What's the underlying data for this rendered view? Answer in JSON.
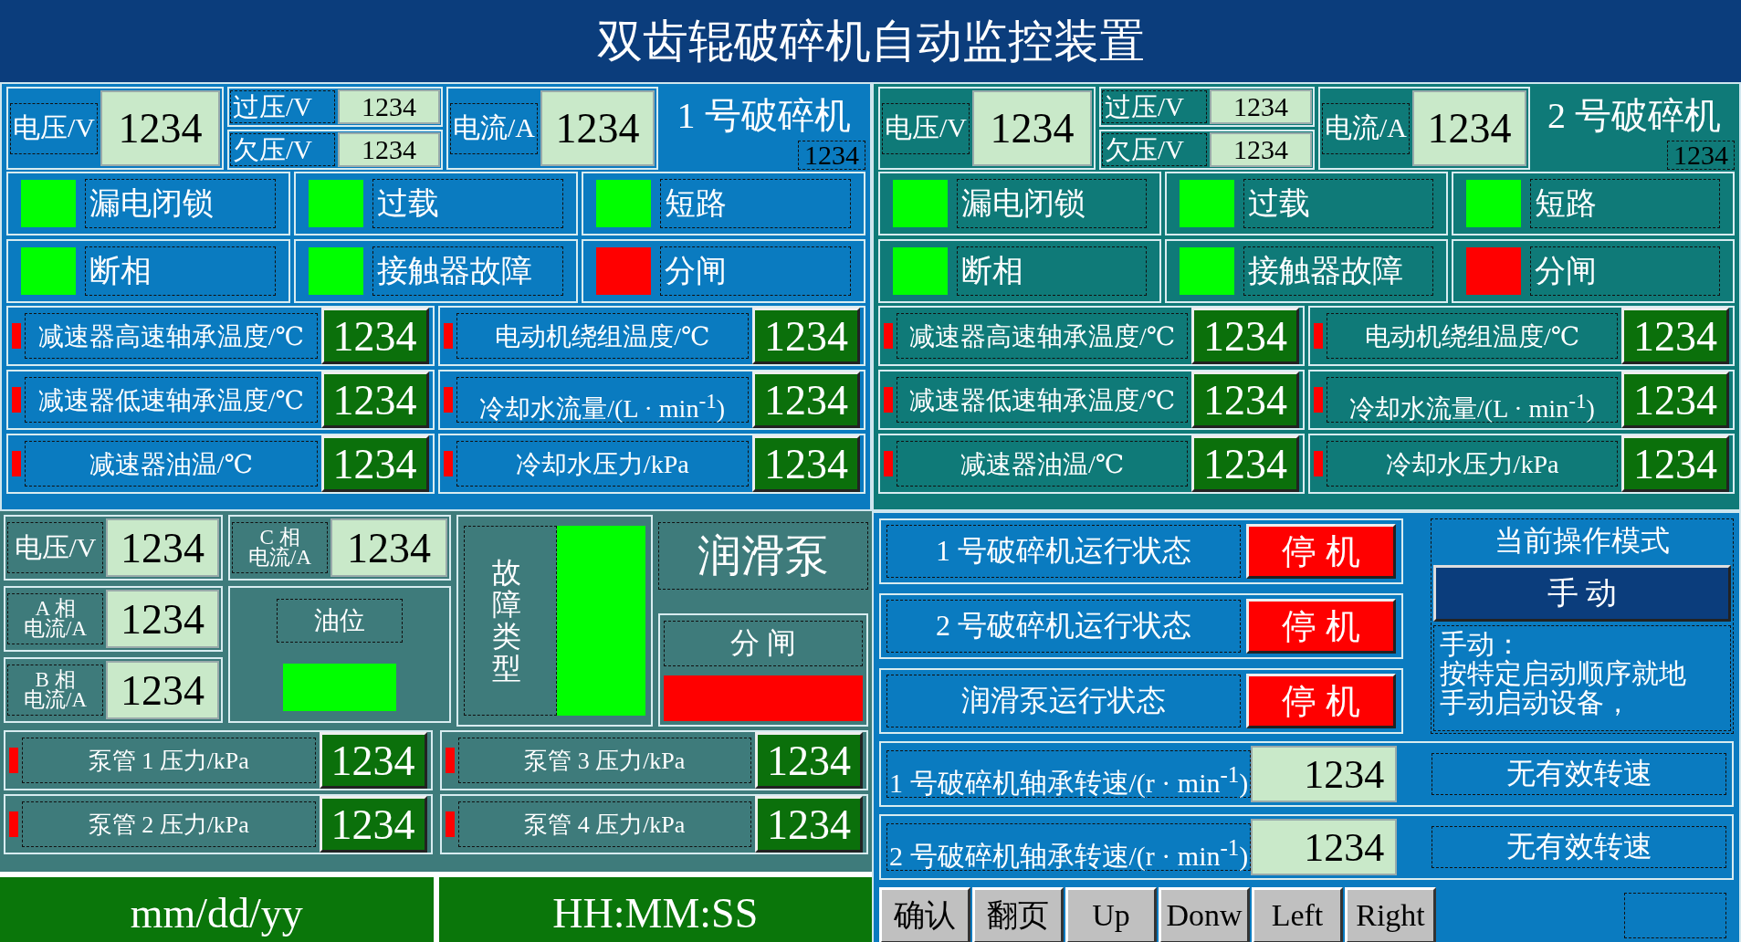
{
  "title": "双齿辊破碎机自动监控装置",
  "crushers": [
    {
      "name": "1 号破碎机",
      "code": "1234",
      "color": "#0a7bc0",
      "voltage": {
        "label": "电压/V",
        "value": "1234"
      },
      "overvoltage": {
        "label": "过压/V",
        "value": "1234"
      },
      "undervoltage": {
        "label": "欠压/V",
        "value": "1234"
      },
      "current": {
        "label": "电流/A",
        "value": "1234"
      },
      "indicators": [
        {
          "label": "漏电闭锁",
          "color": "#00ff00"
        },
        {
          "label": "过载",
          "color": "#00ff00"
        },
        {
          "label": "短路",
          "color": "#00ff00"
        },
        {
          "label": "断相",
          "color": "#00ff00"
        },
        {
          "label": "接触器故障",
          "color": "#00ff00"
        },
        {
          "label": "分闸",
          "color": "#ff0000"
        }
      ],
      "readings": [
        {
          "label": "减速器高速轴承温度/℃",
          "value": "1234",
          "color": "#ff0000"
        },
        {
          "label": "电动机绕组温度/℃",
          "value": "1234",
          "color": "#ff0000"
        },
        {
          "label": "减速器低速轴承温度/℃",
          "value": "1234",
          "color": "#ff0000"
        },
        {
          "label": "冷却水流量/(L · min$^{-1}$)",
          "value": "1234",
          "color": "#ff0000"
        },
        {
          "label": "减速器油温/℃",
          "value": "1234",
          "color": "#ff0000"
        },
        {
          "label": "冷却水压力/kPa",
          "value": "1234",
          "color": "#ff0000"
        }
      ]
    },
    {
      "name": "2 号破碎机",
      "code": "1234",
      "color": "#0f7a78",
      "voltage": {
        "label": "电压/V",
        "value": "1234"
      },
      "overvoltage": {
        "label": "过压/V",
        "value": "1234"
      },
      "undervoltage": {
        "label": "欠压/V",
        "value": "1234"
      },
      "current": {
        "label": "电流/A",
        "value": "1234"
      },
      "indicators": [
        {
          "label": "漏电闭锁",
          "color": "#00ff00"
        },
        {
          "label": "过载",
          "color": "#00ff00"
        },
        {
          "label": "短路",
          "color": "#00ff00"
        },
        {
          "label": "断相",
          "color": "#00ff00"
        },
        {
          "label": "接触器故障",
          "color": "#00ff00"
        },
        {
          "label": "分闸",
          "color": "#ff0000"
        }
      ],
      "readings": [
        {
          "label": "减速器高速轴承温度/℃",
          "value": "1234",
          "color": "#ff0000"
        },
        {
          "label": "电动机绕组温度/℃",
          "value": "1234",
          "color": "#ff0000"
        },
        {
          "label": "减速器低速轴承温度/℃",
          "value": "1234",
          "color": "#ff0000"
        },
        {
          "label": "冷却水流量/(L · min$^{-1}$)",
          "value": "1234",
          "color": "#ff0000"
        },
        {
          "label": "减速器油温/℃",
          "value": "1234",
          "color": "#ff0000"
        },
        {
          "label": "冷却水压力/kPa",
          "value": "1234",
          "color": "#ff0000"
        }
      ]
    }
  ],
  "lube_pump": {
    "title": "润滑泵",
    "electric": [
      {
        "label_lines": [
          "电压/V"
        ],
        "value": "1234"
      },
      {
        "label_lines": [
          "A 相",
          "电流/A"
        ],
        "value": "1234"
      },
      {
        "label_lines": [
          "B 相",
          "电流/A"
        ],
        "value": "1234"
      },
      {
        "label_lines": [
          "C 相",
          "电流/A"
        ],
        "value": "1234"
      }
    ],
    "oil_level": {
      "label": "油位",
      "color": "#00ff00"
    },
    "fault_type": {
      "label": "故障类型",
      "color": "#00ff00"
    },
    "breaker": {
      "label": "分 闸",
      "color": "#ff0000"
    },
    "pipes": [
      {
        "label": "泵管 1 压力/kPa",
        "value": "1234",
        "color": "#ff0000"
      },
      {
        "label": "泵管 3 压力/kPa",
        "value": "1234",
        "color": "#ff0000"
      },
      {
        "label": "泵管 2 压力/kPa",
        "value": "1234",
        "color": "#ff0000"
      },
      {
        "label": "泵管 4 压力/kPa",
        "value": "1234",
        "color": "#ff0000"
      }
    ]
  },
  "date": "mm/dd/yy",
  "time": "HH:MM:SS",
  "run_states": [
    {
      "label": "1 号破碎机运行状态",
      "state": "停 机",
      "color": "#ff0000"
    },
    {
      "label": "2 号破碎机运行状态",
      "state": "停 机",
      "color": "#ff0000"
    },
    {
      "label": "润滑泵运行状态",
      "state": "停 机",
      "color": "#ff0000"
    }
  ],
  "mode": {
    "title": "当前操作模式",
    "value": "手 动",
    "description_heading": "手动：",
    "description": "按特定启动顺序就地手动启动设备，"
  },
  "speeds": [
    {
      "label": "1 号破碎机轴承转速/(r · min$^{-1}$)",
      "value": "1234",
      "note": "无有效转速"
    },
    {
      "label": "2 号破碎机轴承转速/(r · min$^{-1}$)",
      "value": "1234",
      "note": "无有效转速"
    }
  ],
  "buttons": [
    "确认",
    "翻页",
    "Up",
    "Donw",
    "Left",
    "Right"
  ]
}
